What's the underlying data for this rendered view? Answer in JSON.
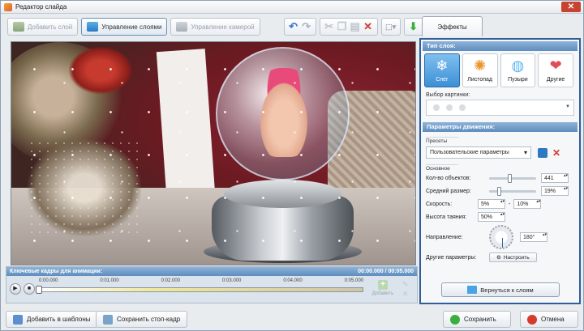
{
  "window": {
    "title": "Редактор слайда",
    "close": "✕"
  },
  "toolbar": {
    "add_layer": "Добавить слой",
    "manage_layers": "Управление слоями",
    "manage_camera": "Управление камерой"
  },
  "tab": {
    "effects": "Эффекты"
  },
  "timeline": {
    "title": "Ключевые кадры для анимации:",
    "time": "00:00.000 / 00:05.000",
    "ticks": [
      "0:00.000",
      "0:01.000",
      "0:02.000",
      "0:03.000",
      "0:04.000",
      "0:05.000"
    ],
    "add_label": "Добавить"
  },
  "panel": {
    "layer_type_header": "Тип слоя:",
    "types": [
      {
        "label": "Снег",
        "icon": "snowflake-icon",
        "selected": true
      },
      {
        "label": "Листопад",
        "icon": "leaf-icon",
        "selected": false
      },
      {
        "label": "Пузыри",
        "icon": "bubble-icon",
        "selected": false
      },
      {
        "label": "Другие",
        "icon": "hearts-icon",
        "selected": false
      }
    ],
    "image_pick_label": "Выбор картинки:",
    "motion_header": "Параметры движения:",
    "presets_label": "Пресеты",
    "preset_value": "Пользовательские параметры",
    "basic_label": "Основное",
    "count_label": "Кол-во объектов:",
    "count_value": "441",
    "count_level": 0.44,
    "size_label": "Средний размер:",
    "size_value": "19%",
    "size_level": 0.19,
    "speed_label": "Скорость:",
    "speed_from": "5%",
    "speed_to": "10%",
    "melt_label": "Высота таяния:",
    "melt_value": "50%",
    "direction_label": "Направление:",
    "direction_value": "180°",
    "other_label": "Другие параметры:",
    "configure_button": "Настроить",
    "back_button": "Вернуться к слоям"
  },
  "bottom": {
    "add_template": "Добавить в шаблоны",
    "save_frame": "Сохранить стоп-кадр",
    "save": "Сохранить",
    "cancel": "Отмена"
  }
}
